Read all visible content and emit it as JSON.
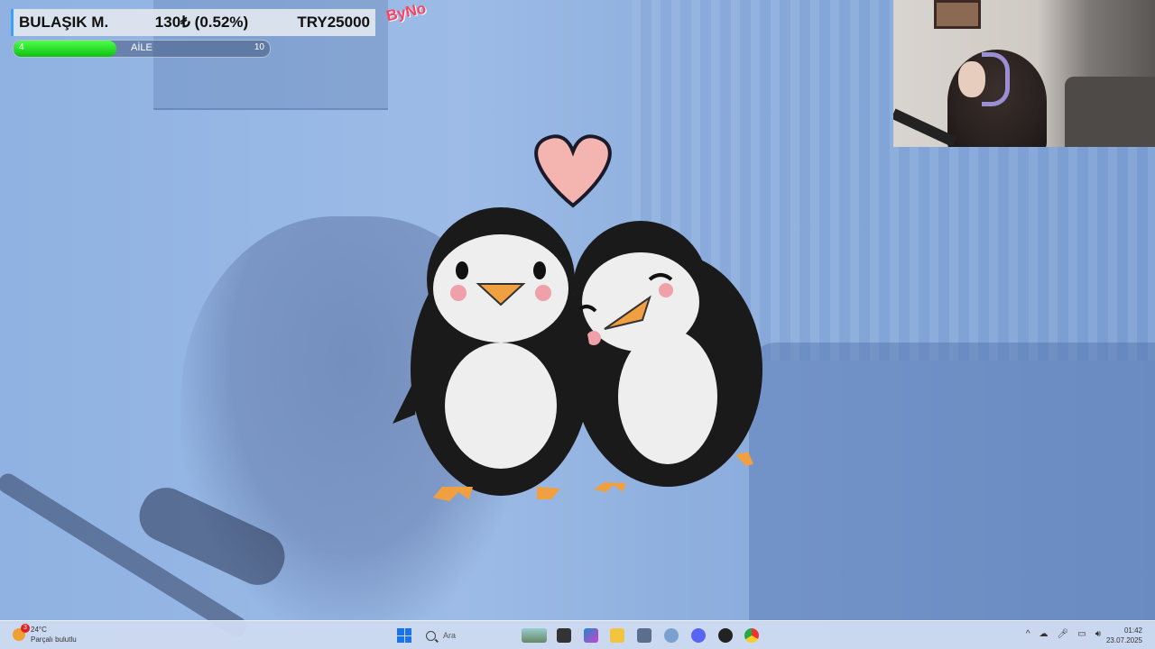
{
  "ticker": {
    "name": "BULAŞIK M.",
    "change": "130₺ (0.52%)",
    "price": "TRY25000"
  },
  "progress": {
    "label": "AİLE",
    "min": "4",
    "max": "10",
    "fraction": 0.4
  },
  "overlay_tag": "ByNo",
  "taskbar": {
    "weather_temp": "24°C",
    "weather_desc": "Parçalı bulutlu",
    "weather_badge": "3",
    "search_placeholder": "Ara",
    "time": "01:42",
    "date": "23.07.2025",
    "apps": [
      "start-icon",
      "search-icon",
      "folder-icon",
      "copilot-icon",
      "explorer-icon",
      "store-icon",
      "settings-icon",
      "discord-icon",
      "obs-icon",
      "chrome-icon"
    ]
  },
  "colors": {
    "tint": "#8fb0df",
    "progress_fill": "#22dd22",
    "ticker_accent": "#3aa0ff",
    "heart": "#f4b5b0"
  }
}
